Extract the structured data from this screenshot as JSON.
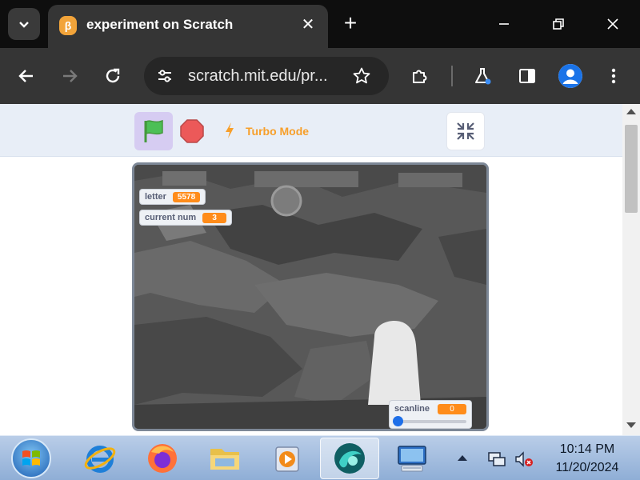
{
  "browser": {
    "tab": {
      "title": "experiment on Scratch",
      "favicon_letter": "β"
    },
    "url": "scratch.mit.edu/pr...",
    "icons": {
      "tab_search": "chevron-down-icon",
      "new_tab": "plus-icon",
      "close_tab": "close-icon",
      "minimize": "minimize-icon",
      "restore": "restore-icon",
      "close_window": "close-icon",
      "back": "back-arrow-icon",
      "forward": "forward-arrow-icon",
      "reload": "reload-icon",
      "site_info": "tune-icon",
      "bookmark": "star-icon",
      "extensions": "puzzle-icon",
      "labs": "flask-icon",
      "side_panel": "side-panel-icon",
      "profile": "account-icon",
      "menu": "kebab-menu-icon"
    },
    "tab_close_glyph": "✕",
    "new_tab_glyph": "+"
  },
  "scratch": {
    "turbo_label": "Turbo Mode",
    "colors": {
      "turbo": "#f79f2a",
      "flag": "#4cbf56",
      "stop": "#ec5959",
      "monitor_value": "#ff8c1a"
    },
    "monitors": [
      {
        "label": "letter",
        "value": "5578"
      },
      {
        "label": "current num",
        "value": "3"
      }
    ],
    "slider": {
      "label": "scanline",
      "value": "0",
      "fraction": 0
    }
  },
  "taskbar": {
    "time": "10:14 PM",
    "date": "11/20/2024",
    "apps": [
      "internet-explorer-icon",
      "firefox-icon",
      "file-explorer-icon",
      "media-player-icon",
      "browser-app-icon",
      "remote-desktop-icon"
    ]
  }
}
